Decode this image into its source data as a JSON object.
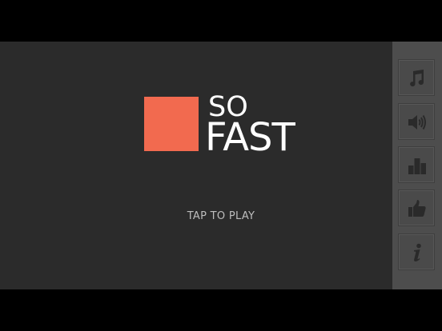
{
  "logo": {
    "line1": "SO",
    "line2": "FAST",
    "square_color": "#f26a4f"
  },
  "prompt": {
    "tap_label": "TAP TO PLAY"
  },
  "side_menu": {
    "buttons": [
      {
        "icon": "music-note-icon"
      },
      {
        "icon": "speaker-icon"
      },
      {
        "icon": "leaderboard-icon"
      },
      {
        "icon": "thumbs-up-icon"
      },
      {
        "icon": "info-icon"
      }
    ]
  },
  "colors": {
    "background": "#2b2b2b",
    "panel": "#4d4d4d",
    "icon": "#2a2a2a",
    "letterbox": "#000000"
  }
}
